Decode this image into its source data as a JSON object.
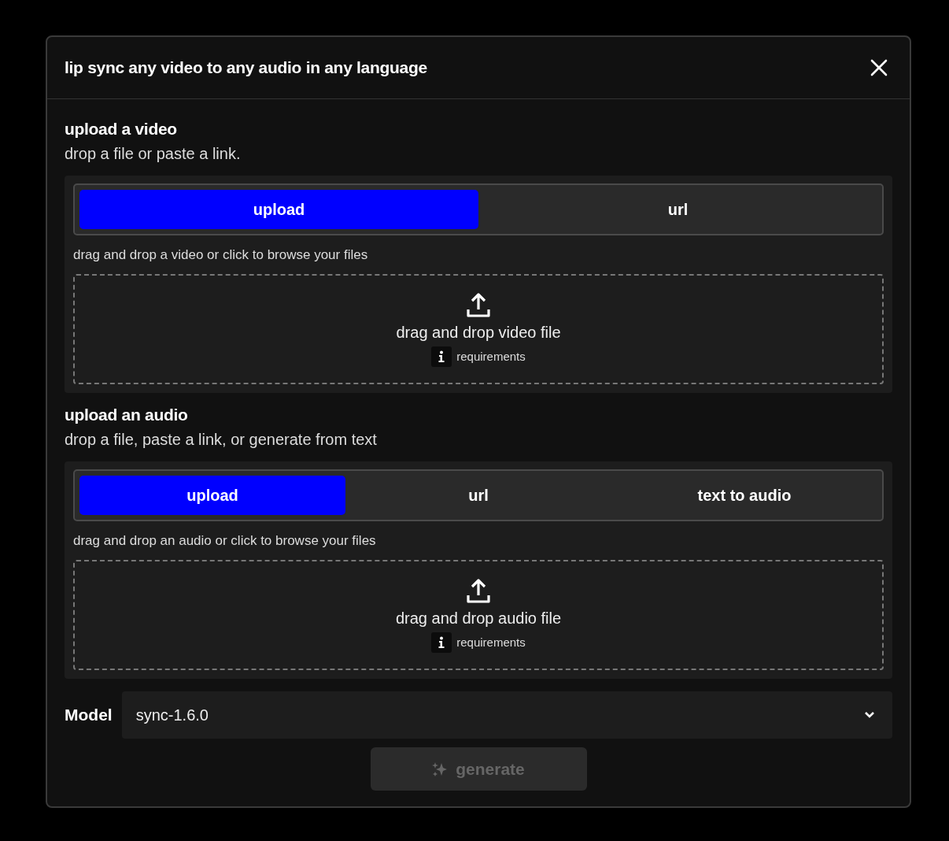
{
  "modal": {
    "title": "lip sync any video to any audio in any language"
  },
  "sections": [
    {
      "title": "upload a video",
      "subtitle": "drop a file or paste a link.",
      "tabs": [
        {
          "label": "upload",
          "selected": true
        },
        {
          "label": "url",
          "selected": false
        }
      ],
      "hint": "drag and drop a video or click to browse your files",
      "dropzone": {
        "label": "drag and drop video file",
        "info": "requirements"
      }
    },
    {
      "title": "upload an audio",
      "subtitle": "drop a file, paste a link, or generate from text",
      "tabs": [
        {
          "label": "upload",
          "selected": true
        },
        {
          "label": "url",
          "selected": false
        },
        {
          "label": "text to audio",
          "selected": false
        }
      ],
      "hint": "drag and drop an audio or click to browse your files",
      "dropzone": {
        "label": "drag and drop audio file",
        "info": "requirements"
      }
    }
  ],
  "model": {
    "label": "Model",
    "value": "sync-1.6.0"
  },
  "generate_button": {
    "label": "generate",
    "disabled": true
  }
}
